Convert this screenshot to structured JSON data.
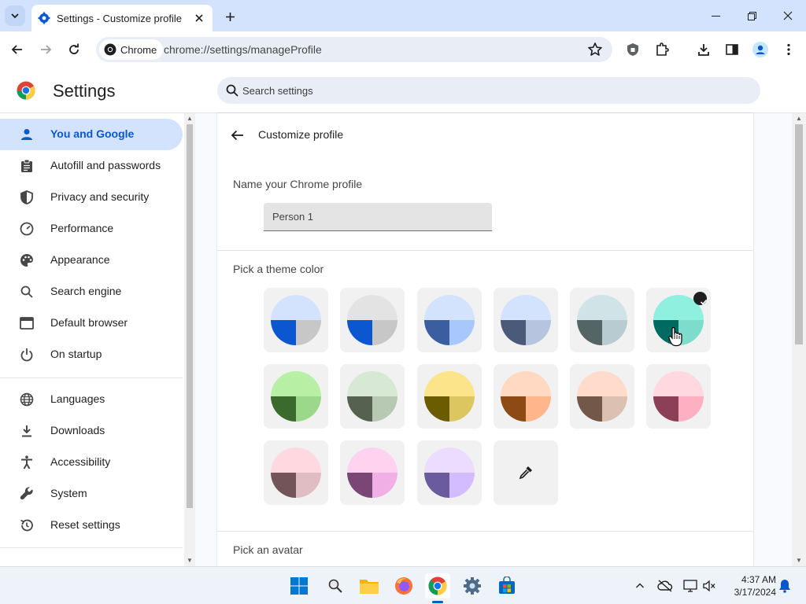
{
  "browser": {
    "tab_title": "Settings - Customize profile",
    "chip_label": "Chrome",
    "url": "chrome://settings/manageProfile"
  },
  "settings": {
    "title": "Settings",
    "search_placeholder": "Search settings"
  },
  "sidebar": {
    "items": [
      {
        "label": "You and Google",
        "icon": "person-icon",
        "active": true
      },
      {
        "label": "Autofill and passwords",
        "icon": "clipboard-icon"
      },
      {
        "label": "Privacy and security",
        "icon": "shield-icon"
      },
      {
        "label": "Performance",
        "icon": "speedometer-icon"
      },
      {
        "label": "Appearance",
        "icon": "palette-icon"
      },
      {
        "label": "Search engine",
        "icon": "search-icon"
      },
      {
        "label": "Default browser",
        "icon": "browser-window-icon"
      },
      {
        "label": "On startup",
        "icon": "power-icon"
      },
      {
        "label": "Languages",
        "icon": "globe-icon"
      },
      {
        "label": "Downloads",
        "icon": "download-icon"
      },
      {
        "label": "Accessibility",
        "icon": "accessibility-icon"
      },
      {
        "label": "System",
        "icon": "wrench-icon"
      },
      {
        "label": "Reset settings",
        "icon": "reset-icon"
      }
    ]
  },
  "profile": {
    "page_title": "Customize profile",
    "name_label": "Name your Chrome profile",
    "name_value": "Person 1",
    "theme_label": "Pick a theme color",
    "avatar_label": "Pick an avatar",
    "themes": [
      {
        "top": "#d3e3fd",
        "left": "#0b57d0",
        "right": "#c7c7c7"
      },
      {
        "top": "#e3e3e3",
        "left": "#0b57d0",
        "right": "#c7c7c7"
      },
      {
        "top": "#d3e3fd",
        "left": "#3b5ea1",
        "right": "#a8c7fa"
      },
      {
        "top": "#d3e3fd",
        "left": "#4c5a7a",
        "right": "#b7c4e0"
      },
      {
        "top": "#d0e4e8",
        "left": "#546565",
        "right": "#b7cbd0"
      },
      {
        "top": "#8ff0e0",
        "left": "#006a60",
        "right": "#7ddccb",
        "selected": true
      },
      {
        "top": "#b7f0a4",
        "left": "#3a6a2c",
        "right": "#9cd88a"
      },
      {
        "top": "#d7e8d4",
        "left": "#56624f",
        "right": "#b8c9b3"
      },
      {
        "top": "#fbe48a",
        "left": "#6b5c00",
        "right": "#dcc660"
      },
      {
        "top": "#ffd9c2",
        "left": "#8e4a14",
        "right": "#ffb68b"
      },
      {
        "top": "#ffdbcb",
        "left": "#735849",
        "right": "#dcc0b1"
      },
      {
        "top": "#ffd8e0",
        "left": "#8c4057",
        "right": "#ffafc2"
      },
      {
        "top": "#ffd8e0",
        "left": "#735459",
        "right": "#e0bdc2"
      },
      {
        "top": "#ffd3f0",
        "left": "#7a4675",
        "right": "#f1b0e5"
      },
      {
        "top": "#ecdcff",
        "left": "#6b5b9e",
        "right": "#d3bcff"
      }
    ],
    "custom_picker_icon": "eyedropper-icon"
  },
  "taskbar": {
    "time": "4:37 AM",
    "date": "3/17/2024"
  }
}
